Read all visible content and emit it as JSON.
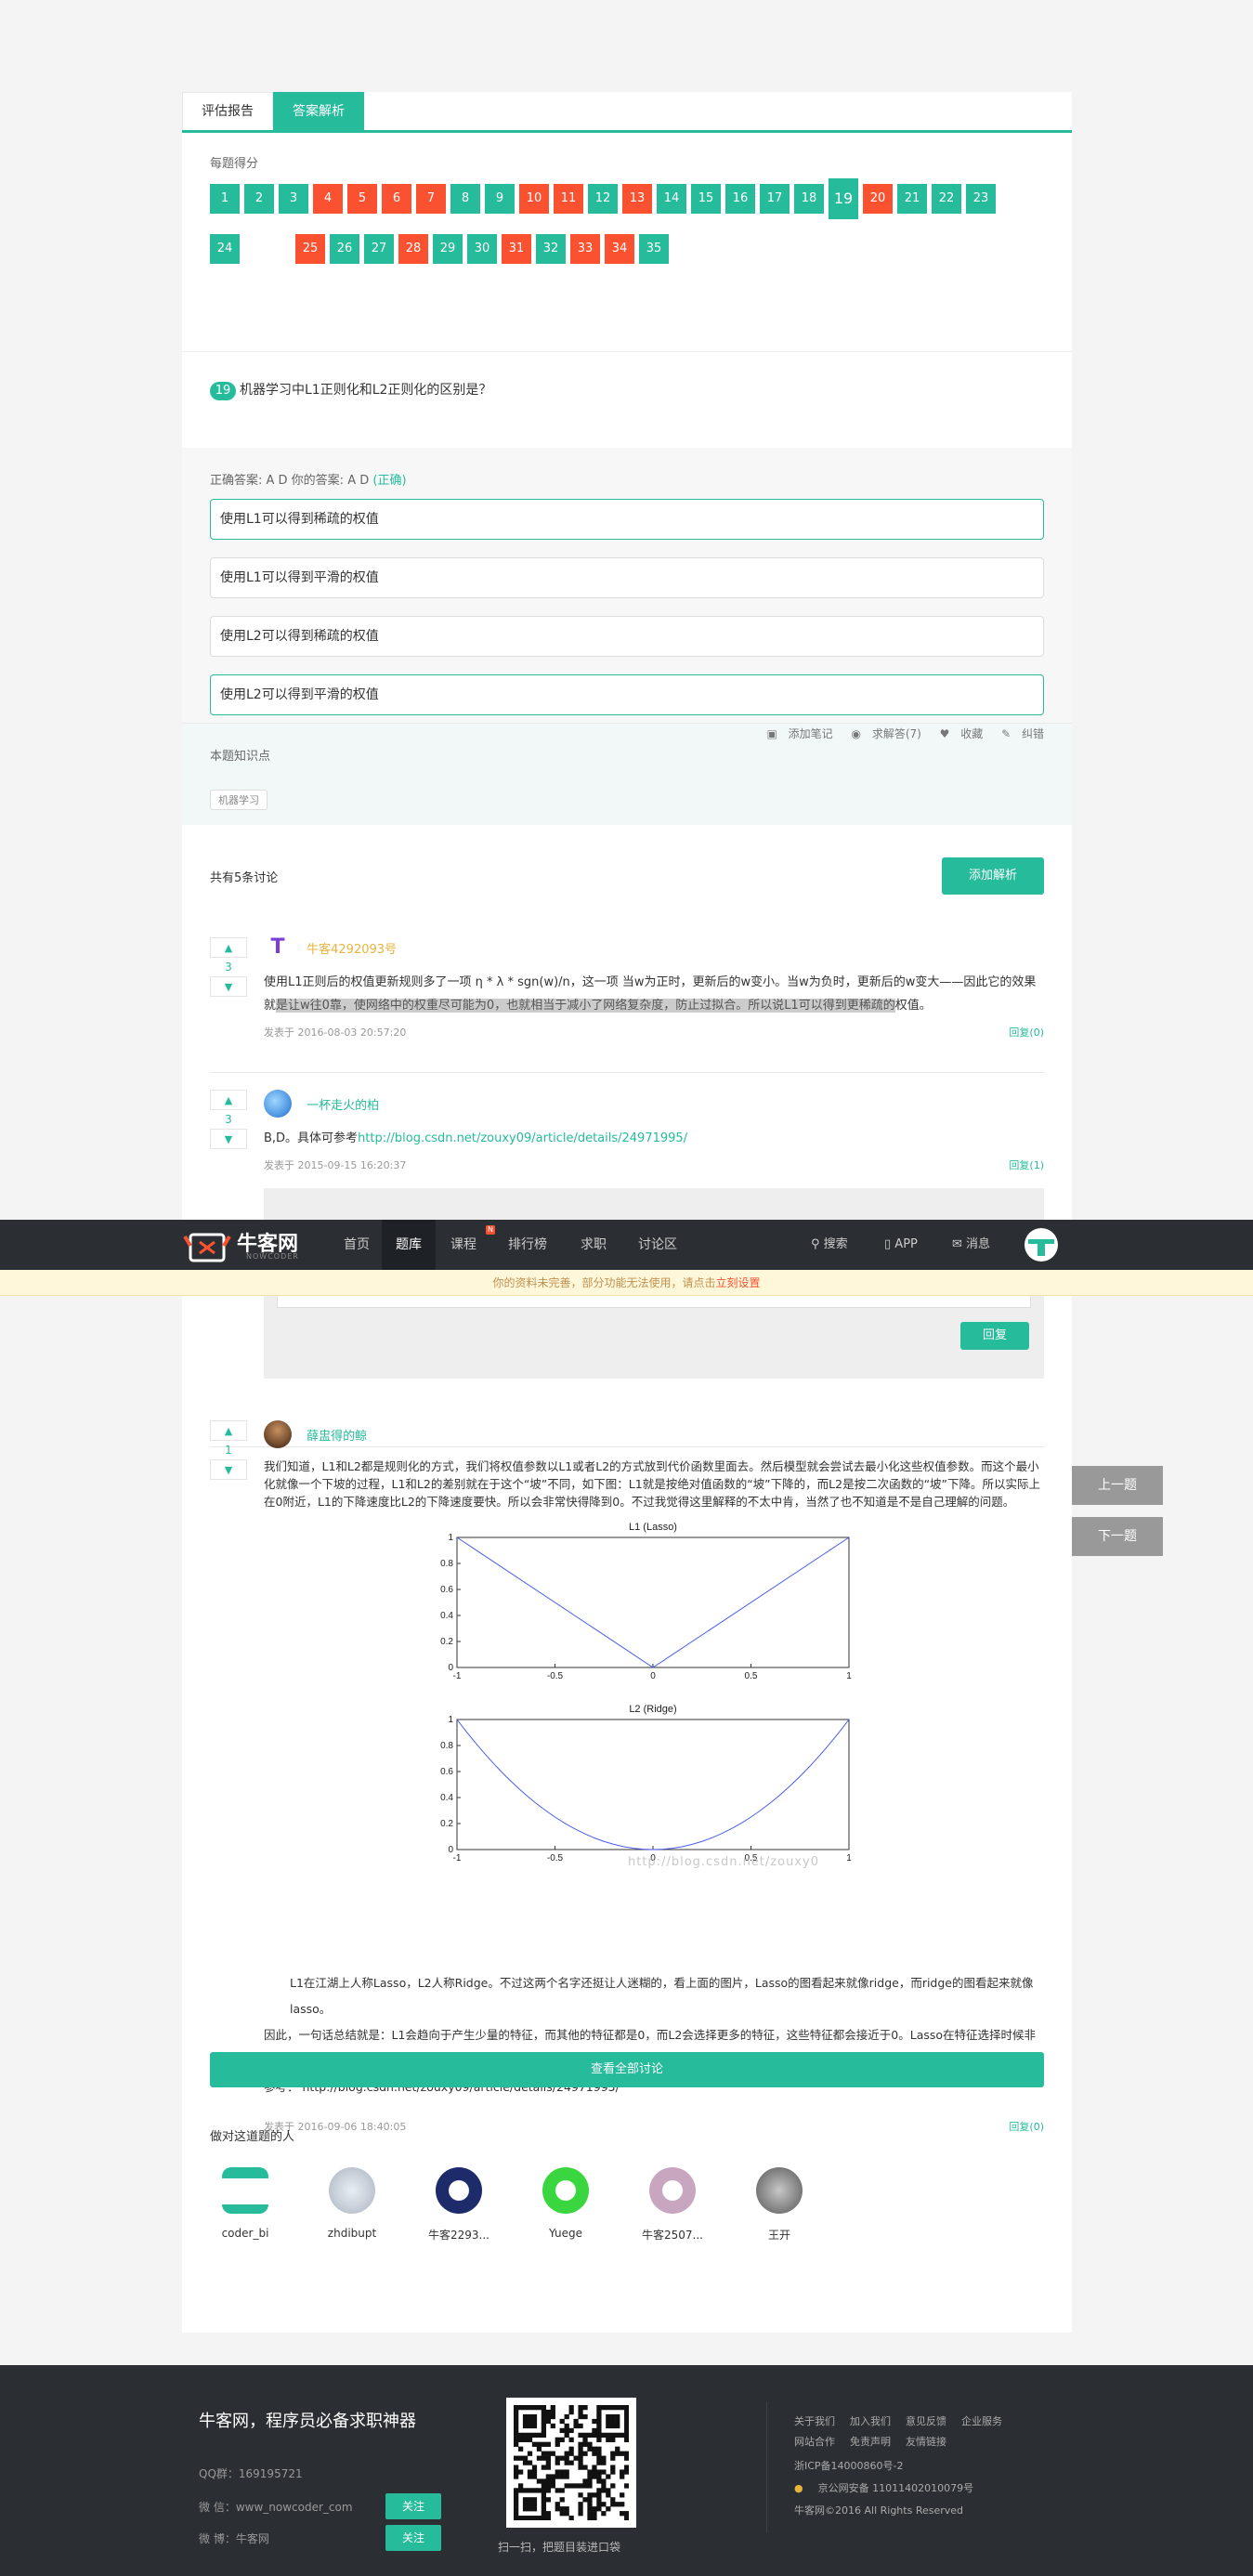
{
  "tabs": {
    "report": "评估报告",
    "analysis": "答案解析"
  },
  "score": {
    "label": "每题得分",
    "current": 19,
    "items": [
      {
        "n": "1",
        "s": "ok"
      },
      {
        "n": "2",
        "s": "ok"
      },
      {
        "n": "3",
        "s": "ok"
      },
      {
        "n": "4",
        "s": "bad"
      },
      {
        "n": "5",
        "s": "bad"
      },
      {
        "n": "6",
        "s": "bad"
      },
      {
        "n": "7",
        "s": "bad"
      },
      {
        "n": "8",
        "s": "ok"
      },
      {
        "n": "9",
        "s": "ok"
      },
      {
        "n": "10",
        "s": "bad"
      },
      {
        "n": "11",
        "s": "bad"
      },
      {
        "n": "12",
        "s": "ok"
      },
      {
        "n": "13",
        "s": "bad"
      },
      {
        "n": "14",
        "s": "ok"
      },
      {
        "n": "15",
        "s": "ok"
      },
      {
        "n": "16",
        "s": "ok"
      },
      {
        "n": "17",
        "s": "ok"
      },
      {
        "n": "18",
        "s": "ok"
      },
      {
        "n": "19",
        "s": "cur"
      },
      {
        "n": "20",
        "s": "bad"
      },
      {
        "n": "21",
        "s": "ok"
      },
      {
        "n": "22",
        "s": "ok"
      },
      {
        "n": "23",
        "s": "ok"
      },
      {
        "n": "24",
        "s": "ok"
      },
      {
        "n": "25",
        "s": "bad"
      },
      {
        "n": "26",
        "s": "ok"
      },
      {
        "n": "27",
        "s": "ok"
      },
      {
        "n": "28",
        "s": "bad"
      },
      {
        "n": "29",
        "s": "ok"
      },
      {
        "n": "30",
        "s": "ok"
      },
      {
        "n": "31",
        "s": "bad"
      },
      {
        "n": "32",
        "s": "ok"
      },
      {
        "n": "33",
        "s": "bad"
      },
      {
        "n": "34",
        "s": "bad"
      },
      {
        "n": "35",
        "s": "ok"
      }
    ]
  },
  "question": {
    "num": "19",
    "text": "机器学习中L1正则化和L2正则化的区别是？"
  },
  "answer": {
    "correct_label": "正确答案: A D   你的答案: A D",
    "status": "(正确)",
    "options": [
      {
        "text": "使用L1可以得到稀疏的权值",
        "selected": true
      },
      {
        "text": "使用L1可以得到平滑的权值",
        "selected": false
      },
      {
        "text": "使用L2可以得到稀疏的权值",
        "selected": false
      },
      {
        "text": "使用L2可以得到平滑的权值",
        "selected": true
      }
    ],
    "tools": {
      "note": "添加笔记",
      "help": "求解答(7)",
      "fav": "收藏",
      "err": "纠错"
    }
  },
  "knowledge": {
    "title": "本题知识点",
    "tag": "机器学习"
  },
  "discussion": {
    "count_label": "共有5条讨论",
    "add_button": "添加解析",
    "view_all": "查看全部讨论",
    "c1": {
      "votes": "3",
      "user": "牛客4292093号",
      "text_a": "使用L1正则后的权值更新规则多了一项 η * λ * sgn(w)/n，这一项 当w为正时，更新后的w变小。当w为负时，更新后的w变大——因此它的效果就",
      "text_hl": "是让w往0靠，使网络中的权重尽可能为0，也就相当于减小了网络复杂度，防止过拟合。所以说L1可以得到更稀疏的",
      "text_b": "权值。",
      "time": "发表于 2016-08-03 20:57:20",
      "reply": "回复(0)"
    },
    "c2": {
      "votes": "3",
      "user": "一杯走火的柏",
      "text": "B,D。具体可参考",
      "link": "http://blog.csdn.net/zouxy09/article/details/24971995/",
      "time": "发表于 2015-09-15 16:20:37",
      "reply": "回复(1)",
      "reply_button": "回复"
    },
    "c3": {
      "votes": "1",
      "user": "薛盅得的鲸",
      "text": "我们知道，L1和L2都是规则化的方式，我们将权值参数以L1或者L2的方式放到代价函数里面去。然后模型就会尝试去最小化这些权值参数。而这个最小化就像一个下坡的过程，L1和L2的差别就在于这个“坡”不同，如下图：L1就是按绝对值函数的“坡”下降的，而L2是按二次函数的“坡”下降。所以实际上在0附近，L1的下降速度比L2的下降速度要快。所以会非常快得降到0。不过我觉得这里解释的不太中肯，当然了也不知道是不是自己理解的问题。",
      "p2": "L1在江湖上人称Lasso，L2人称Ridge。不过这两个名字还挺让人迷糊的，看上面的图片，Lasso的图看起来就像ridge，而ridge的图看起来就像lasso。",
      "p3": "因此，一句话总结就是：L1会趋向于产生少量的特征，而其他的特征都是0，而L2会选择更多的特征，这些特征都会接近于0。Lasso在特征选择时候非常有用，而Ridge就只是一种规则化而已。",
      "p4": "参考：  http://blog.csdn.net/zouxy09/article/details/24971995/",
      "watermark": "http://blog.csdn.net/zouxy0",
      "time": "发表于 2016-09-06 18:40:05",
      "reply": "回复(0)"
    }
  },
  "chart_data": [
    {
      "type": "line",
      "title": "L1 (Lasso)",
      "x": [
        -1,
        0,
        1
      ],
      "y": [
        1,
        0,
        1
      ],
      "xlim": [
        -1,
        1
      ],
      "ylim": [
        0,
        1
      ],
      "xticks": [
        "-1",
        "-0.5",
        "0",
        "0.5",
        "1"
      ],
      "yticks": [
        "0",
        "0.2",
        "0.4",
        "0.6",
        "0.8",
        "1"
      ],
      "color": "#4a5cf0"
    },
    {
      "type": "line",
      "title": "L2 (Ridge)",
      "x": [
        -1,
        -0.8,
        -0.6,
        -0.4,
        -0.2,
        0,
        0.2,
        0.4,
        0.6,
        0.8,
        1
      ],
      "y": [
        1,
        0.64,
        0.36,
        0.16,
        0.04,
        0,
        0.04,
        0.16,
        0.36,
        0.64,
        1
      ],
      "xlim": [
        -1,
        1
      ],
      "ylim": [
        0,
        1
      ],
      "xticks": [
        "-1",
        "-0.5",
        "0",
        "0.5",
        "1"
      ],
      "yticks": [
        "0",
        "0.2",
        "0.4",
        "0.6",
        "0.8",
        "1"
      ],
      "color": "#4a5cf0"
    }
  ],
  "people": {
    "title": "做对这道题的人",
    "list": [
      "coder_bi",
      "zhdibupt",
      "牛客2293...",
      "Yuege",
      "牛客2507...",
      "王开"
    ]
  },
  "nav": {
    "logo": "牛客网",
    "logo_sub": "NOWCODER",
    "items": [
      "首页",
      "题库",
      "课程",
      "排行榜",
      "求职",
      "讨论区"
    ],
    "badge": "N",
    "search": "搜索",
    "app": "APP",
    "msg": "消息"
  },
  "notice": {
    "text": "你的资料未完善，部分功能无法使用，请点击",
    "link": "立刻设置"
  },
  "side": {
    "prev": "上一题",
    "next": "下一题"
  },
  "footer": {
    "title": "牛客网，程序员必备求职神器",
    "qq": "QQ群：169195721",
    "wechat": "微 信：www_nowcoder_com",
    "weibo": "微 博：牛客网",
    "follow": "关注",
    "qr_caption": "扫一扫，把题目装进口袋",
    "links1": [
      "关于我们",
      "加入我们",
      "意见反馈",
      "企业服务"
    ],
    "links2": [
      "网站合作",
      "免责声明",
      "友情链接"
    ],
    "icp": "浙ICP备14000860号-2",
    "police": "京公网安备 11011402010079号",
    "copyright": "牛客网©2016 All Rights Reserved"
  }
}
